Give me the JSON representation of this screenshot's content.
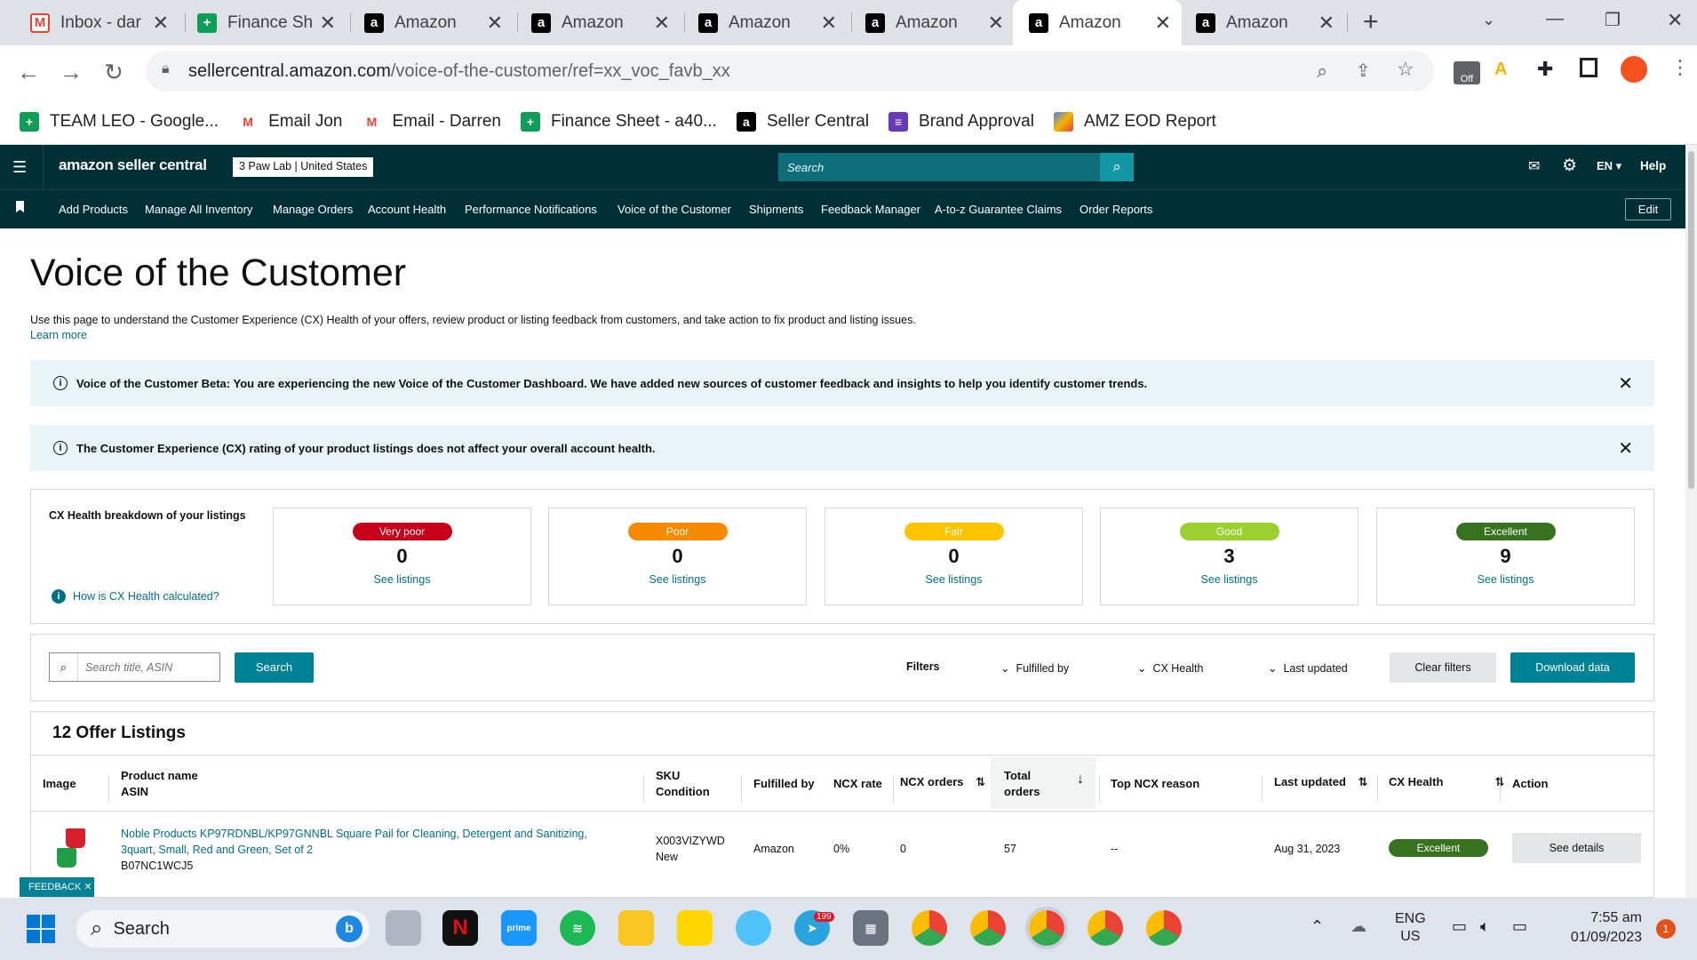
{
  "browser": {
    "tabs": [
      {
        "title": "Inbox - dar",
        "icon": "gmail-icon"
      },
      {
        "title": "Finance She",
        "icon": "sheets-icon"
      },
      {
        "title": "Amazon",
        "icon": "amazon-icon"
      },
      {
        "title": "Amazon",
        "icon": "amazon-icon"
      },
      {
        "title": "Amazon",
        "icon": "amazon-icon"
      },
      {
        "title": "Amazon",
        "icon": "amazon-icon"
      },
      {
        "title": "Amazon",
        "icon": "amazon-icon",
        "active": true
      },
      {
        "title": "Amazon",
        "icon": "amazon-icon"
      }
    ],
    "url_host": "sellercentral.amazon.com",
    "url_path": "/voice-of-the-customer/ref=xx_voc_favb_xx",
    "extension_badge": "Off",
    "bookmarks": [
      {
        "label": "TEAM LEO - Google...",
        "icon": "sheets-icon",
        "color": "#0f9d58"
      },
      {
        "label": "Email Jon",
        "icon": "gmail-icon",
        "color": "#ea4335"
      },
      {
        "label": "Email - Darren",
        "icon": "gmail-icon",
        "color": "#ea4335"
      },
      {
        "label": "Finance Sheet - a40...",
        "icon": "sheets-icon",
        "color": "#0f9d58"
      },
      {
        "label": "Seller Central",
        "icon": "amazon-icon",
        "color": "#000000"
      },
      {
        "label": "Brand Approval",
        "icon": "forms-icon",
        "color": "#673ab7"
      },
      {
        "label": "AMZ EOD Report",
        "icon": "colorful-icon",
        "color": "#f4b400"
      }
    ]
  },
  "header": {
    "logo": "amazon seller central",
    "store": "3 Paw Lab",
    "marketplace": "United States",
    "search_placeholder": "Search",
    "language": "EN",
    "help": "Help"
  },
  "nav": {
    "items": [
      "Add Products",
      "Manage All Inventory",
      "Manage Orders",
      "Account Health",
      "Performance Notifications",
      "Voice of the Customer",
      "Shipments",
      "Feedback Manager",
      "A-to-z Guarantee Claims",
      "Order Reports"
    ],
    "edit": "Edit"
  },
  "page": {
    "title": "Voice of the Customer",
    "description": "Use this page to understand the Customer Experience (CX) Health of your offers, review product or listing feedback from customers, and take action to fix product and listing issues.",
    "learn_more": "Learn more",
    "banner1": "Voice of the Customer Beta: You are experiencing the new Voice of the Customer Dashboard. We have added new sources of customer feedback and insights to help you identify customer trends.",
    "banner2": "The Customer Experience (CX) rating of your product listings does not affect your overall account health."
  },
  "breakdown": {
    "title": "CX Health breakdown of your listings",
    "help_link": "How is CX Health calculated?",
    "see_label": "See listings",
    "cards": [
      {
        "label": "Very poor",
        "count": "0",
        "color": "#c7001b"
      },
      {
        "label": "Poor",
        "count": "0",
        "color": "#f68a00"
      },
      {
        "label": "Fair",
        "count": "0",
        "color": "#ffc400"
      },
      {
        "label": "Good",
        "count": "3",
        "color": "#9ad12e"
      },
      {
        "label": "Excellent",
        "count": "9",
        "color": "#37731e"
      }
    ]
  },
  "filters": {
    "search_placeholder": "Search title, ASIN",
    "search_button": "Search",
    "filters_label": "Filters",
    "fulfilled_by": "Fulfilled by",
    "cx_health": "CX Health",
    "last_updated": "Last updated",
    "clear": "Clear filters",
    "download": "Download data"
  },
  "table": {
    "title": "12 Offer Listings",
    "headers": {
      "image": "Image",
      "product_name": "Product name",
      "asin": "ASIN",
      "sku": "SKU",
      "condition": "Condition",
      "fulfilled_by": "Fulfilled by",
      "ncx_rate": "NCX rate",
      "ncx_orders": "NCX orders",
      "total": "Total",
      "orders": "orders",
      "top_ncx": "Top NCX reason",
      "last_updated": "Last updated",
      "cx_health": "CX Health",
      "action": "Action"
    },
    "rows": [
      {
        "product_line1": "Noble Products KP97RDNBL/KP97GNNBL Square Pail for Cleaning, Detergent and Sanitizing,",
        "product_line2": "3quart, Small, Red and Green, Set of 2",
        "asin": "B07NC1WCJ5",
        "sku": "X003VIZYWD",
        "condition": "New",
        "fulfilled_by": "Amazon",
        "ncx_rate": "0%",
        "ncx_orders": "0",
        "total_orders": "57",
        "top_ncx": "--",
        "last_updated": "Aug 31, 2023",
        "cx_health": "Excellent",
        "action": "See details"
      }
    ]
  },
  "feedback_tab": "FEEDBACK",
  "taskbar": {
    "search": "Search",
    "telegram_badge": "199",
    "lang1": "ENG",
    "lang2": "US",
    "time": "7:55 am",
    "date": "01/09/2023",
    "notif": "1"
  }
}
